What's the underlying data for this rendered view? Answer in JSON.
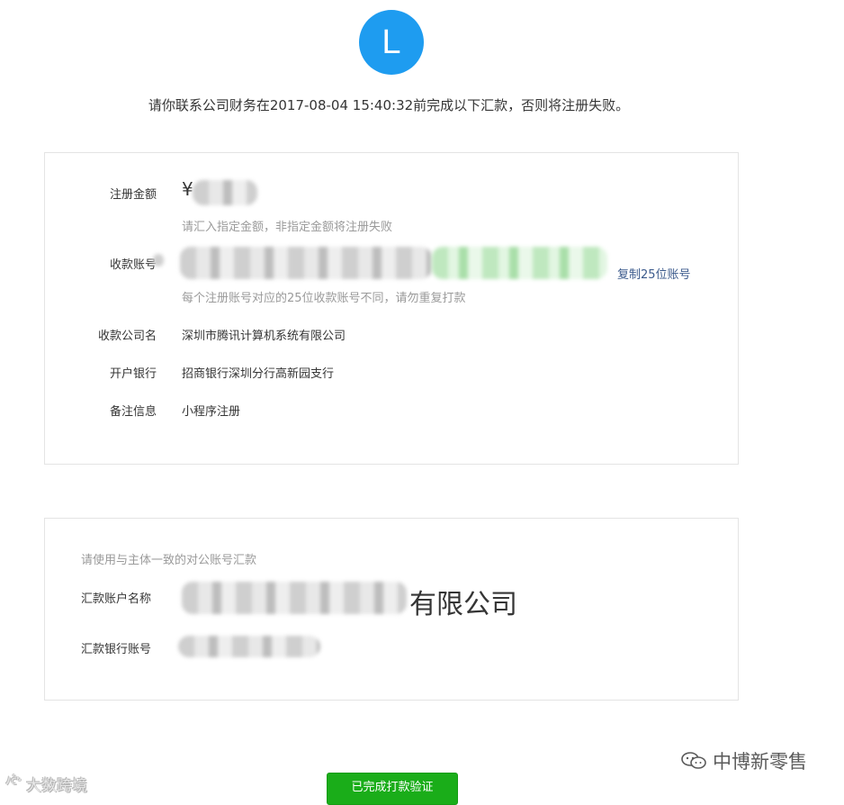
{
  "avatar": {
    "letter": "L",
    "color": "#1e9cf0"
  },
  "notice": "请你联系公司财务在2017-08-04 15:40:32前完成以下汇款，否则将注册失败。",
  "payment_info": {
    "amount_label": "注册金额",
    "amount_currency": "¥",
    "amount_hint": "请汇入指定金额，非指定金额将注册失败",
    "account_label": "收款账号",
    "copy_label": "复制25位账号",
    "account_hint": "每个注册账号对应的25位收款账号不同，请勿重复打款",
    "company_label": "收款公司名",
    "company_value": "深圳市腾讯计算机系统有限公司",
    "bank_label": "开户银行",
    "bank_value": "招商银行深圳分行高新园支行",
    "remark_label": "备注信息",
    "remark_value": "小程序注册"
  },
  "payer_info": {
    "title": "请使用与主体一致的对公账号汇款",
    "name_label": "汇款账户名称",
    "name_visible_suffix": "有限公司",
    "account_label": "汇款银行账号"
  },
  "done_button": {
    "label": "已完成打款验证",
    "color": "#1aad19"
  },
  "watermarks": {
    "right": "中博新零售",
    "left": "大数跨境"
  }
}
